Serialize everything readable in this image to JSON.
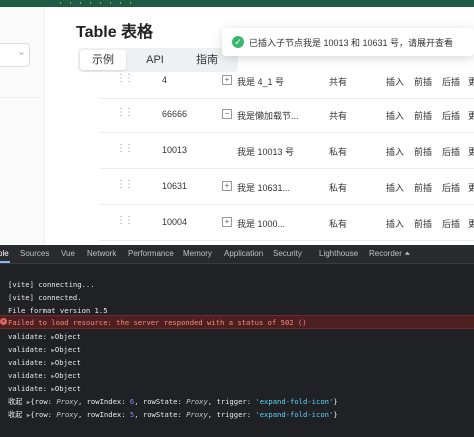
{
  "page": {
    "title": "Table 表格",
    "tabs": [
      {
        "label": "示例",
        "active": true
      },
      {
        "label": "API",
        "active": false
      },
      {
        "label": "指南",
        "active": false
      }
    ],
    "toast": {
      "message": "已插入子节点我是 10013 和 10631 号，请展开查看",
      "icon": "check-circle-icon",
      "color": "#3ab56e"
    },
    "rows": [
      {
        "id": "4",
        "expand": "+",
        "name": "我是 4_1 号",
        "type": "共有",
        "actions": [
          "插入",
          "前插",
          "后插",
          "更"
        ]
      },
      {
        "id": "66666",
        "expand": "−",
        "name": "我是懒加载节...",
        "type": "共有",
        "actions": [
          "插入",
          "前插",
          "后插",
          "更"
        ]
      },
      {
        "id": "10013",
        "expand": "",
        "name": "我是 10013 号",
        "type": "私有",
        "actions": [
          "插入",
          "前插",
          "后插",
          "更"
        ]
      },
      {
        "id": "10631",
        "expand": "+",
        "name": "我是 10631...",
        "type": "私有",
        "actions": [
          "插入",
          "前插",
          "后插",
          "更"
        ]
      },
      {
        "id": "10004",
        "expand": "+",
        "name": "我是 1000...",
        "type": "私有",
        "actions": [
          "插入",
          "前插",
          "后插",
          "更"
        ]
      }
    ]
  },
  "devtools": {
    "tabs": [
      "ole",
      "Sources",
      "Vue",
      "Network",
      "Performance",
      "Memory",
      "Application",
      "Security",
      "Lighthouse",
      "Recorder ⏶"
    ],
    "active_tab": "ole",
    "console": {
      "log1": "[vite] connecting...",
      "log2": "[vite] connected.",
      "log3": "File format version 1.5",
      "error": "Failed to load resource: the server responded with a status of 502 ()",
      "validate_label": "validate:",
      "object_label": "Object",
      "validate_count": 5,
      "fold_label": "收起",
      "fold1": {
        "rowIndex": "6",
        "trigger": "'expand-fold-icon'"
      },
      "fold2": {
        "rowIndex": "5",
        "trigger": "'expand-fold-icon'"
      },
      "row_key": "row:",
      "proxy": "Proxy",
      "rowIndex_key": "rowIndex:",
      "rowState_key": "rowState:",
      "trigger_key": "trigger:"
    }
  },
  "colors": {
    "topbar": "#1e5c45",
    "devtools_bg": "#202124",
    "error_bg": "#4e1f1f",
    "success": "#3ab56e"
  }
}
